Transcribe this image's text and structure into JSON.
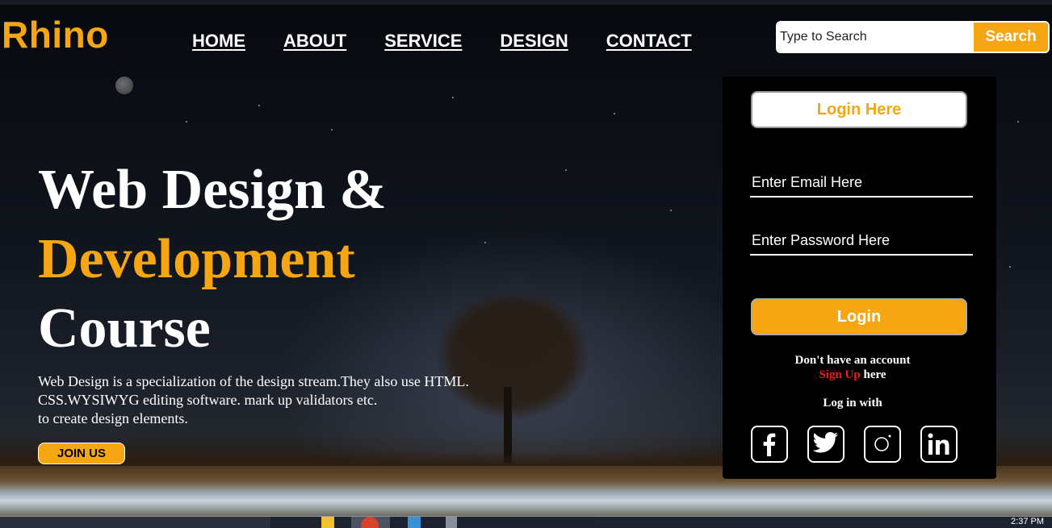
{
  "brand": {
    "name": "Rhino"
  },
  "nav": {
    "items": [
      "HOME",
      "ABOUT",
      "SERVICE",
      "DESIGN",
      "CONTACT"
    ]
  },
  "search": {
    "placeholder": "Type to Search",
    "button_label": "Search"
  },
  "hero": {
    "line1": "Web Design &",
    "line2": "Development",
    "line3": "Course",
    "description": [
      "Web Design is a specialization of the design stream.They also use HTML.",
      "CSS.WYSIWYG editing software. mark up validators etc.",
      "to create design elements."
    ],
    "join_label": "JOIN US"
  },
  "login": {
    "header_label": "Login Here",
    "email_placeholder": "Enter Email Here",
    "password_placeholder": "Enter Password Here",
    "button_label": "Login",
    "no_account_text": "Don't have an account",
    "signup_link": "Sign Up",
    "signup_suffix": " here",
    "login_with_text": "Log in with",
    "socials": [
      "facebook-icon",
      "twitter-icon",
      "instagram-icon",
      "linkedin-icon"
    ]
  },
  "taskbar": {
    "clock": "2:37 PM"
  },
  "colors": {
    "accent": "#f5a612",
    "signup": "#e3221b",
    "panel": "#000000"
  }
}
